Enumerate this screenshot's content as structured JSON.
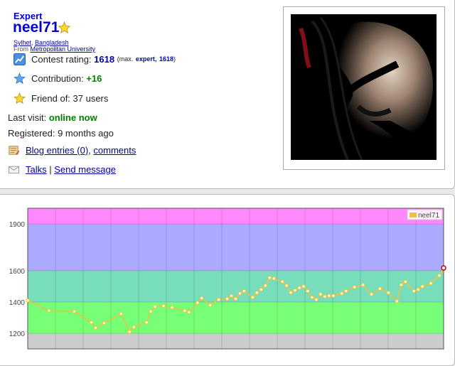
{
  "profile": {
    "rank": "Expert",
    "handle": "neel71",
    "city": "Sylhet",
    "country": "Bangladesh",
    "from_label": "From",
    "organization": "Metropolitan University",
    "contest_rating_label": "Contest rating:",
    "contest_rating": "1618",
    "max_prefix": "(max.",
    "max_rank": "expert,",
    "max_rating": "1618",
    "max_suffix": ")",
    "contribution_label": "Contribution:",
    "contribution": "+16",
    "friend_of": "Friend of: 37 users",
    "last_visit_label": "Last visit:",
    "last_visit": "online now",
    "registered": "Registered: 9 months ago",
    "blog_link": "Blog entries (0)",
    "comments_link": "comments",
    "talks_link": "Talks",
    "separator": "|",
    "send_message_link": "Send message"
  },
  "colors": {
    "handle": "#0000cc",
    "rating": "#0000aa",
    "contribution": "#008000",
    "line": "#edc240"
  },
  "chart_data": {
    "type": "line",
    "yticks": [
      "1900",
      "1600",
      "1400",
      "1200"
    ],
    "ylim": [
      1100,
      2000
    ],
    "legend": "neel71",
    "legend_position": "top-right",
    "grid": true,
    "bands": [
      {
        "from": 1100,
        "to": 1200,
        "color": "#cccccc"
      },
      {
        "from": 1200,
        "to": 1400,
        "color": "#77ff77"
      },
      {
        "from": 1400,
        "to": 1600,
        "color": "#77ddbb"
      },
      {
        "from": 1600,
        "to": 1900,
        "color": "#aaaaff"
      },
      {
        "from": 1900,
        "to": 2000,
        "color": "#ff88ff"
      }
    ],
    "series": [
      {
        "name": "neel71",
        "color": "#edc240",
        "x": [
          0,
          5,
          11,
          15,
          16,
          18,
          22,
          24,
          25,
          28,
          29,
          30,
          32,
          34,
          37,
          38,
          40,
          41,
          43,
          45,
          47,
          48,
          49,
          50,
          51,
          53,
          54,
          55,
          56,
          57,
          58,
          60,
          61,
          62,
          63,
          64,
          65,
          66,
          67,
          68,
          69,
          70,
          71,
          72,
          74,
          75,
          77,
          79,
          81,
          83,
          85,
          87,
          88,
          89,
          91,
          92,
          93,
          95,
          97,
          98
        ],
        "values": [
          1410,
          1345,
          1340,
          1270,
          1235,
          1265,
          1325,
          1210,
          1240,
          1270,
          1340,
          1370,
          1375,
          1365,
          1345,
          1335,
          1395,
          1425,
          1380,
          1415,
          1420,
          1440,
          1420,
          1455,
          1470,
          1430,
          1460,
          1480,
          1505,
          1555,
          1550,
          1530,
          1505,
          1460,
          1475,
          1490,
          1500,
          1470,
          1430,
          1415,
          1450,
          1435,
          1440,
          1440,
          1455,
          1470,
          1495,
          1510,
          1450,
          1485,
          1460,
          1405,
          1510,
          1530,
          1470,
          1480,
          1500,
          1520,
          1570,
          1618
        ]
      }
    ]
  }
}
